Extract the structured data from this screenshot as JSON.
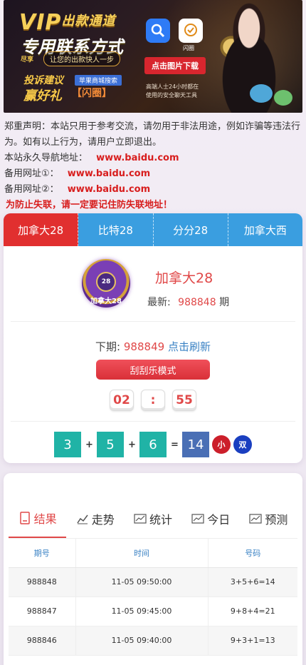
{
  "banner": {
    "vip": "VIP",
    "vip_sub": "出款通道",
    "title": "专用联系方式",
    "logo": "尽享",
    "slogan": "让您的出款快人一步",
    "complain": "投诉建议",
    "prize": "赢好礼",
    "flash": "【闪圈】",
    "search_tag": "苹果商城搜索",
    "app1_icon": "search-icon",
    "app2_label": "闪圈",
    "download": "点击图片下载",
    "note": "高端人士24小时都在 使用的安全聊天工具"
  },
  "notice": {
    "disclaimer": "郑重声明：本站只用于参考交流，请勿用于非法用途，例如诈骗等违法行为。如有以上行为，请用户立即退出。",
    "nav_label": "本站永久导航地址：",
    "nav_url": "www.baidu.com",
    "backup1_label": "备用网址①：",
    "backup1_url": "www.baidu.com",
    "backup2_label": "备用网址②：",
    "backup2_url": "www.baidu.com",
    "warning": "为防止失联，请一定要记住防失联地址！"
  },
  "lottery": {
    "tabs": [
      "加拿大28",
      "比特28",
      "分分28",
      "加拿大西"
    ],
    "active_tab": 0,
    "logo_ball": "28",
    "logo_label": "加拿大28",
    "game_name": "加拿大28",
    "latest_label": "最新:",
    "latest_issue": "988848",
    "latest_suffix": "期",
    "next_label": "下期:",
    "next_issue": "988849",
    "refresh_label": "点击刷新",
    "mode_button": "刮刮乐模式",
    "timer_min": "02",
    "timer_sep": ":",
    "timer_sec": "55",
    "result": {
      "a": "3",
      "b": "5",
      "c": "6",
      "sum": "14",
      "size": "小",
      "parity": "双"
    },
    "colors": {
      "active_tab": "#e12f2f",
      "tab_bar": "#3a9ee0",
      "ball": "#20b3a6",
      "sum": "#4a6fb5"
    }
  },
  "history": {
    "tabs": [
      {
        "label": "结果",
        "icon": "result-icon"
      },
      {
        "label": "走势",
        "icon": "trend-icon"
      },
      {
        "label": "统计",
        "icon": "stats-icon"
      },
      {
        "label": "今日",
        "icon": "today-icon"
      },
      {
        "label": "预测",
        "icon": "forecast-icon"
      }
    ],
    "columns": [
      "期号",
      "时间",
      "号码"
    ],
    "rows": [
      [
        "988848",
        "11-05 09:50:00",
        "3+5+6=14"
      ],
      [
        "988847",
        "11-05 09:45:00",
        "9+8+4=21"
      ],
      [
        "988846",
        "11-05 09:40:00",
        "9+3+1=13"
      ]
    ]
  }
}
